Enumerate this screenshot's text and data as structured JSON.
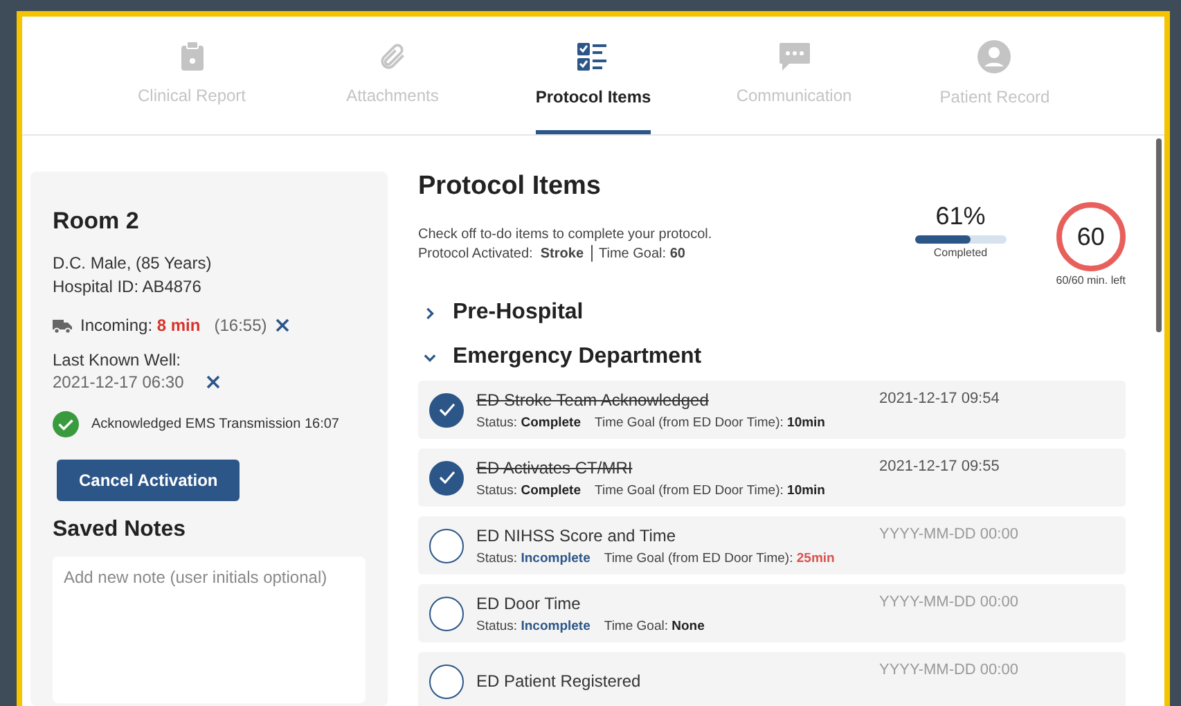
{
  "tabs": [
    {
      "label": "Clinical Report",
      "selected": false
    },
    {
      "label": "Attachments",
      "selected": false
    },
    {
      "label": "Protocol Items",
      "selected": true
    },
    {
      "label": "Communication",
      "selected": false
    },
    {
      "label": "Patient Record",
      "selected": false
    }
  ],
  "sidebar": {
    "room": "Room 2",
    "patient": "D.C. Male, (85 Years)",
    "hospital_id": "Hospital ID: AB4876",
    "incoming": {
      "label": "Incoming:",
      "eta": "8 min",
      "time": "(16:55)"
    },
    "last_known_well": {
      "label": "Last Known Well:",
      "value": "2021-12-17 06:30"
    },
    "acknowledgment": {
      "text": "Acknowledged EMS Transmission 16:07",
      "checked": true
    },
    "cancel_button": "Cancel Activation",
    "saved_notes": {
      "title": "Saved Notes",
      "placeholder": "Add new note (user initials optional)"
    }
  },
  "main": {
    "title": "Protocol Items",
    "instructions": "Check off to-do items to complete your protocol.",
    "activated_label": "Protocol Activated:",
    "protocol": "Stroke",
    "time_goal_label": "Time Goal:",
    "time_goal": "60",
    "progress": {
      "percent": "61%",
      "level": 0.61,
      "label": "Completed"
    },
    "timer": {
      "value": "60",
      "caption": "60/60 min. left"
    },
    "sections": [
      {
        "title": "Pre-Hospital",
        "expanded": false
      },
      {
        "title": "Emergency Department",
        "expanded": true,
        "items": [
          {
            "title": "ED Stroke Team Acknowledged",
            "checked": true,
            "status_label": "Status:",
            "status": "Complete",
            "goal_label": "Time Goal (from ED Door Time):",
            "goal": "10min",
            "overdue": false,
            "timestamp": "2021-12-17 09:54"
          },
          {
            "title": "ED Activates CT/MRI",
            "checked": true,
            "status_label": "Status:",
            "status": "Complete",
            "goal_label": "Time Goal (from ED Door Time):",
            "goal": "10min",
            "overdue": false,
            "timestamp": "2021-12-17 09:55"
          },
          {
            "title": "ED NIHSS Score and Time",
            "checked": false,
            "status_label": "Status:",
            "status": "Incomplete",
            "goal_label": "Time Goal (from ED Door Time):",
            "goal": "25min",
            "overdue": true,
            "placeholder": "YYYY-MM-DD 00:00"
          },
          {
            "title": "ED Door Time",
            "checked": false,
            "status_label": "Status:",
            "status": "Incomplete",
            "goal_label": "Time Goal:",
            "goal": "None",
            "overdue": false,
            "placeholder": "YYYY-MM-DD 00:00"
          },
          {
            "title": "ED Patient Registered",
            "checked": false,
            "placeholder": "YYYY-MM-DD 00:00"
          }
        ]
      }
    ]
  }
}
